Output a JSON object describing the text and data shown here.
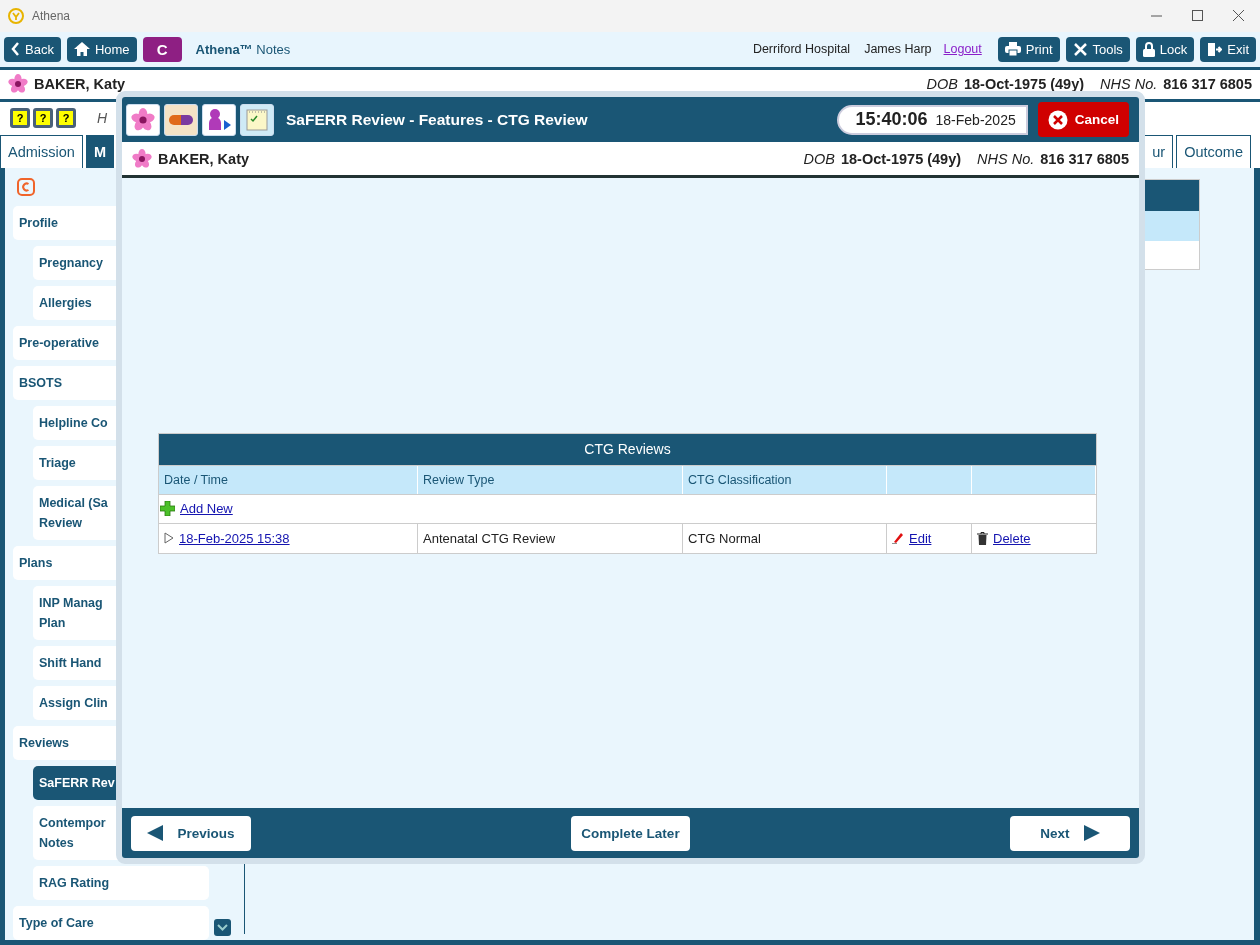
{
  "window": {
    "title": "Athena"
  },
  "toolbar": {
    "left_buttons": [
      {
        "kind": "back",
        "label": "Back"
      },
      {
        "kind": "home",
        "label": "Home"
      }
    ],
    "badge": "C",
    "app_name": "Athena™",
    "app_suffix": "Notes",
    "hospital": "Derriford Hospital",
    "user": "James Harp",
    "logout": "Logout",
    "right_buttons": [
      {
        "kind": "print",
        "label": "Print"
      },
      {
        "kind": "tools",
        "label": "Tools"
      },
      {
        "kind": "lock",
        "label": "Lock"
      },
      {
        "kind": "exit",
        "label": "Exit"
      }
    ]
  },
  "patient": {
    "name": "BAKER, Katy",
    "dob_label": "DOB",
    "dob": "18-Oct-1975 (49y)",
    "nhs_label": "NHS No.",
    "nhs": "816 317 6805"
  },
  "info_strip": {
    "help_buttons": [
      {
        "glyph": "?"
      },
      {
        "glyph": "?"
      },
      {
        "glyph": "?"
      }
    ],
    "text": "H"
  },
  "tabs": {
    "left": [
      {
        "label": "Admission",
        "selected": false
      },
      {
        "label": "M",
        "selected": true
      }
    ],
    "right": [
      {
        "label": "ur",
        "selected": false
      },
      {
        "label": "Outcome",
        "selected": false
      }
    ]
  },
  "sidebar": {
    "items": [
      {
        "label": "Profile",
        "selected": false,
        "children": [
          {
            "label": "Pregnancy",
            "selected": false
          },
          {
            "label": "Allergies",
            "selected": false
          }
        ]
      },
      {
        "label": "Pre-operative",
        "selected": false
      },
      {
        "label": "BSOTS",
        "selected": false,
        "children": [
          {
            "label": "Helpline Co",
            "selected": false
          },
          {
            "label": "Triage",
            "selected": false
          },
          {
            "label": "Medical (Sa\nReview",
            "selected": false
          }
        ]
      },
      {
        "label": "Plans",
        "selected": false,
        "children": [
          {
            "label": "INP Manag\nPlan",
            "selected": false
          },
          {
            "label": "Shift Hand",
            "selected": false
          },
          {
            "label": "Assign Clin",
            "selected": false
          }
        ]
      },
      {
        "label": "Reviews",
        "selected": false,
        "children": [
          {
            "label": "SaFERR Rev",
            "selected": true
          },
          {
            "label": "Contempor\nNotes",
            "selected": false
          },
          {
            "label": "RAG Rating",
            "selected": false
          }
        ]
      },
      {
        "label": "Type of Care",
        "selected": false
      }
    ]
  },
  "modal": {
    "title": "SaFERR Review - Features - CTG Review",
    "time": "15:40:06",
    "date": "18-Feb-2025",
    "cancel": "Cancel",
    "patient": {
      "name": "BAKER, Katy",
      "dob_label": "DOB",
      "dob": "18-Oct-1975 (49y)",
      "nhs_label": "NHS No.",
      "nhs": "816 317 6805"
    },
    "table": {
      "title": "CTG Reviews",
      "columns": [
        "Date / Time",
        "Review Type",
        "CTG Classification"
      ],
      "add_new": "Add New",
      "rows": [
        {
          "date_time": "18-Feb-2025 15:38",
          "review_type": "Antenatal CTG Review",
          "classification": "CTG Normal",
          "edit": "Edit",
          "delete": "Delete"
        }
      ]
    },
    "footer": {
      "previous": "Previous",
      "complete_later": "Complete Later",
      "next": "Next"
    }
  }
}
